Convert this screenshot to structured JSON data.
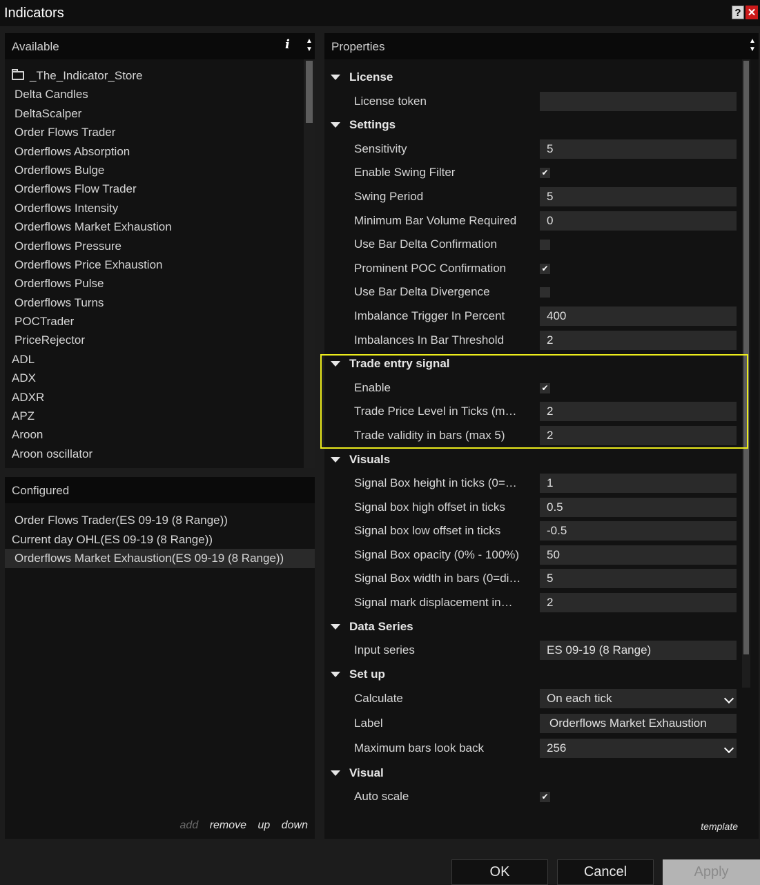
{
  "window": {
    "title": "Indicators",
    "help": "?",
    "close": "✕"
  },
  "available": {
    "header": "Available",
    "info": "i",
    "folder": "_The_Indicator_Store",
    "items": [
      "Delta Candles",
      "DeltaScalper",
      "Order Flows Trader",
      "Orderflows Absorption",
      "Orderflows Bulge",
      "Orderflows Flow Trader",
      "Orderflows Intensity",
      "Orderflows Market Exhaustion",
      "Orderflows Pressure",
      "Orderflows Price Exhaustion",
      "Orderflows Pulse",
      "Orderflows Turns",
      "POCTrader",
      "PriceRejector"
    ],
    "flat_items": [
      "ADL",
      "ADX",
      "ADXR",
      "APZ",
      "Aroon",
      "Aroon oscillator"
    ]
  },
  "configured": {
    "header": "Configured",
    "items": [
      "Order Flows Trader(ES 09-19 (8 Range))",
      "Current day OHL(ES 09-19 (8 Range))",
      "Orderflows Market Exhaustion(ES 09-19 (8 Range))"
    ],
    "actions": {
      "add": "add",
      "remove": "remove",
      "up": "up",
      "down": "down"
    }
  },
  "properties": {
    "header": "Properties",
    "template": "template",
    "license": {
      "title": "License",
      "token_label": "License token",
      "token_value": ""
    },
    "settings": {
      "title": "Settings",
      "sensitivity": {
        "label": "Sensitivity",
        "value": "5"
      },
      "swing_filter": {
        "label": "Enable Swing Filter",
        "checked": "✔"
      },
      "swing_period": {
        "label": "Swing Period",
        "value": "5"
      },
      "min_volume": {
        "label": "Minimum Bar Volume Required",
        "value": "0"
      },
      "delta_conf": {
        "label": "Use Bar Delta Confirmation",
        "checked": ""
      },
      "poc_conf": {
        "label": "Prominent POC Confirmation",
        "checked": "✔"
      },
      "delta_div": {
        "label": "Use Bar Delta Divergence",
        "checked": ""
      },
      "imb_trigger": {
        "label": "Imbalance Trigger In Percent",
        "value": "400"
      },
      "imb_threshold": {
        "label": "Imbalances In Bar Threshold",
        "value": "2"
      }
    },
    "trade_entry": {
      "title": "Trade entry signal",
      "enable": {
        "label": "Enable",
        "checked": "✔"
      },
      "price_level": {
        "label": "Trade Price Level in Ticks (m…",
        "value": "2"
      },
      "validity": {
        "label": "Trade validity in bars (max 5)",
        "value": "2"
      }
    },
    "visuals": {
      "title": "Visuals",
      "box_height": {
        "label": "Signal Box height in ticks (0=…",
        "value": "1"
      },
      "high_offset": {
        "label": "Signal box high offset in ticks",
        "value": "0.5"
      },
      "low_offset": {
        "label": "Signal box low offset in ticks",
        "value": "-0.5"
      },
      "opacity": {
        "label": "Signal Box opacity (0% - 100%)",
        "value": "50"
      },
      "box_width": {
        "label": "Signal Box width in bars (0=di…",
        "value": "5"
      },
      "mark_disp": {
        "label": "Signal mark displacement in…",
        "value": "2"
      }
    },
    "data_series": {
      "title": "Data Series",
      "input": {
        "label": "Input series",
        "value": "ES 09-19 (8 Range)"
      }
    },
    "setup": {
      "title": "Set up",
      "calculate": {
        "label": "Calculate",
        "value": "On each tick"
      },
      "label": {
        "label": "Label",
        "value": "Orderflows Market Exhaustion"
      },
      "max_bars": {
        "label": "Maximum bars look back",
        "value": "256"
      }
    },
    "visual": {
      "title": "Visual",
      "auto_scale": {
        "label": "Auto scale",
        "checked": "✔"
      }
    }
  },
  "buttons": {
    "ok": "OK",
    "cancel": "Cancel",
    "apply": "Apply"
  }
}
